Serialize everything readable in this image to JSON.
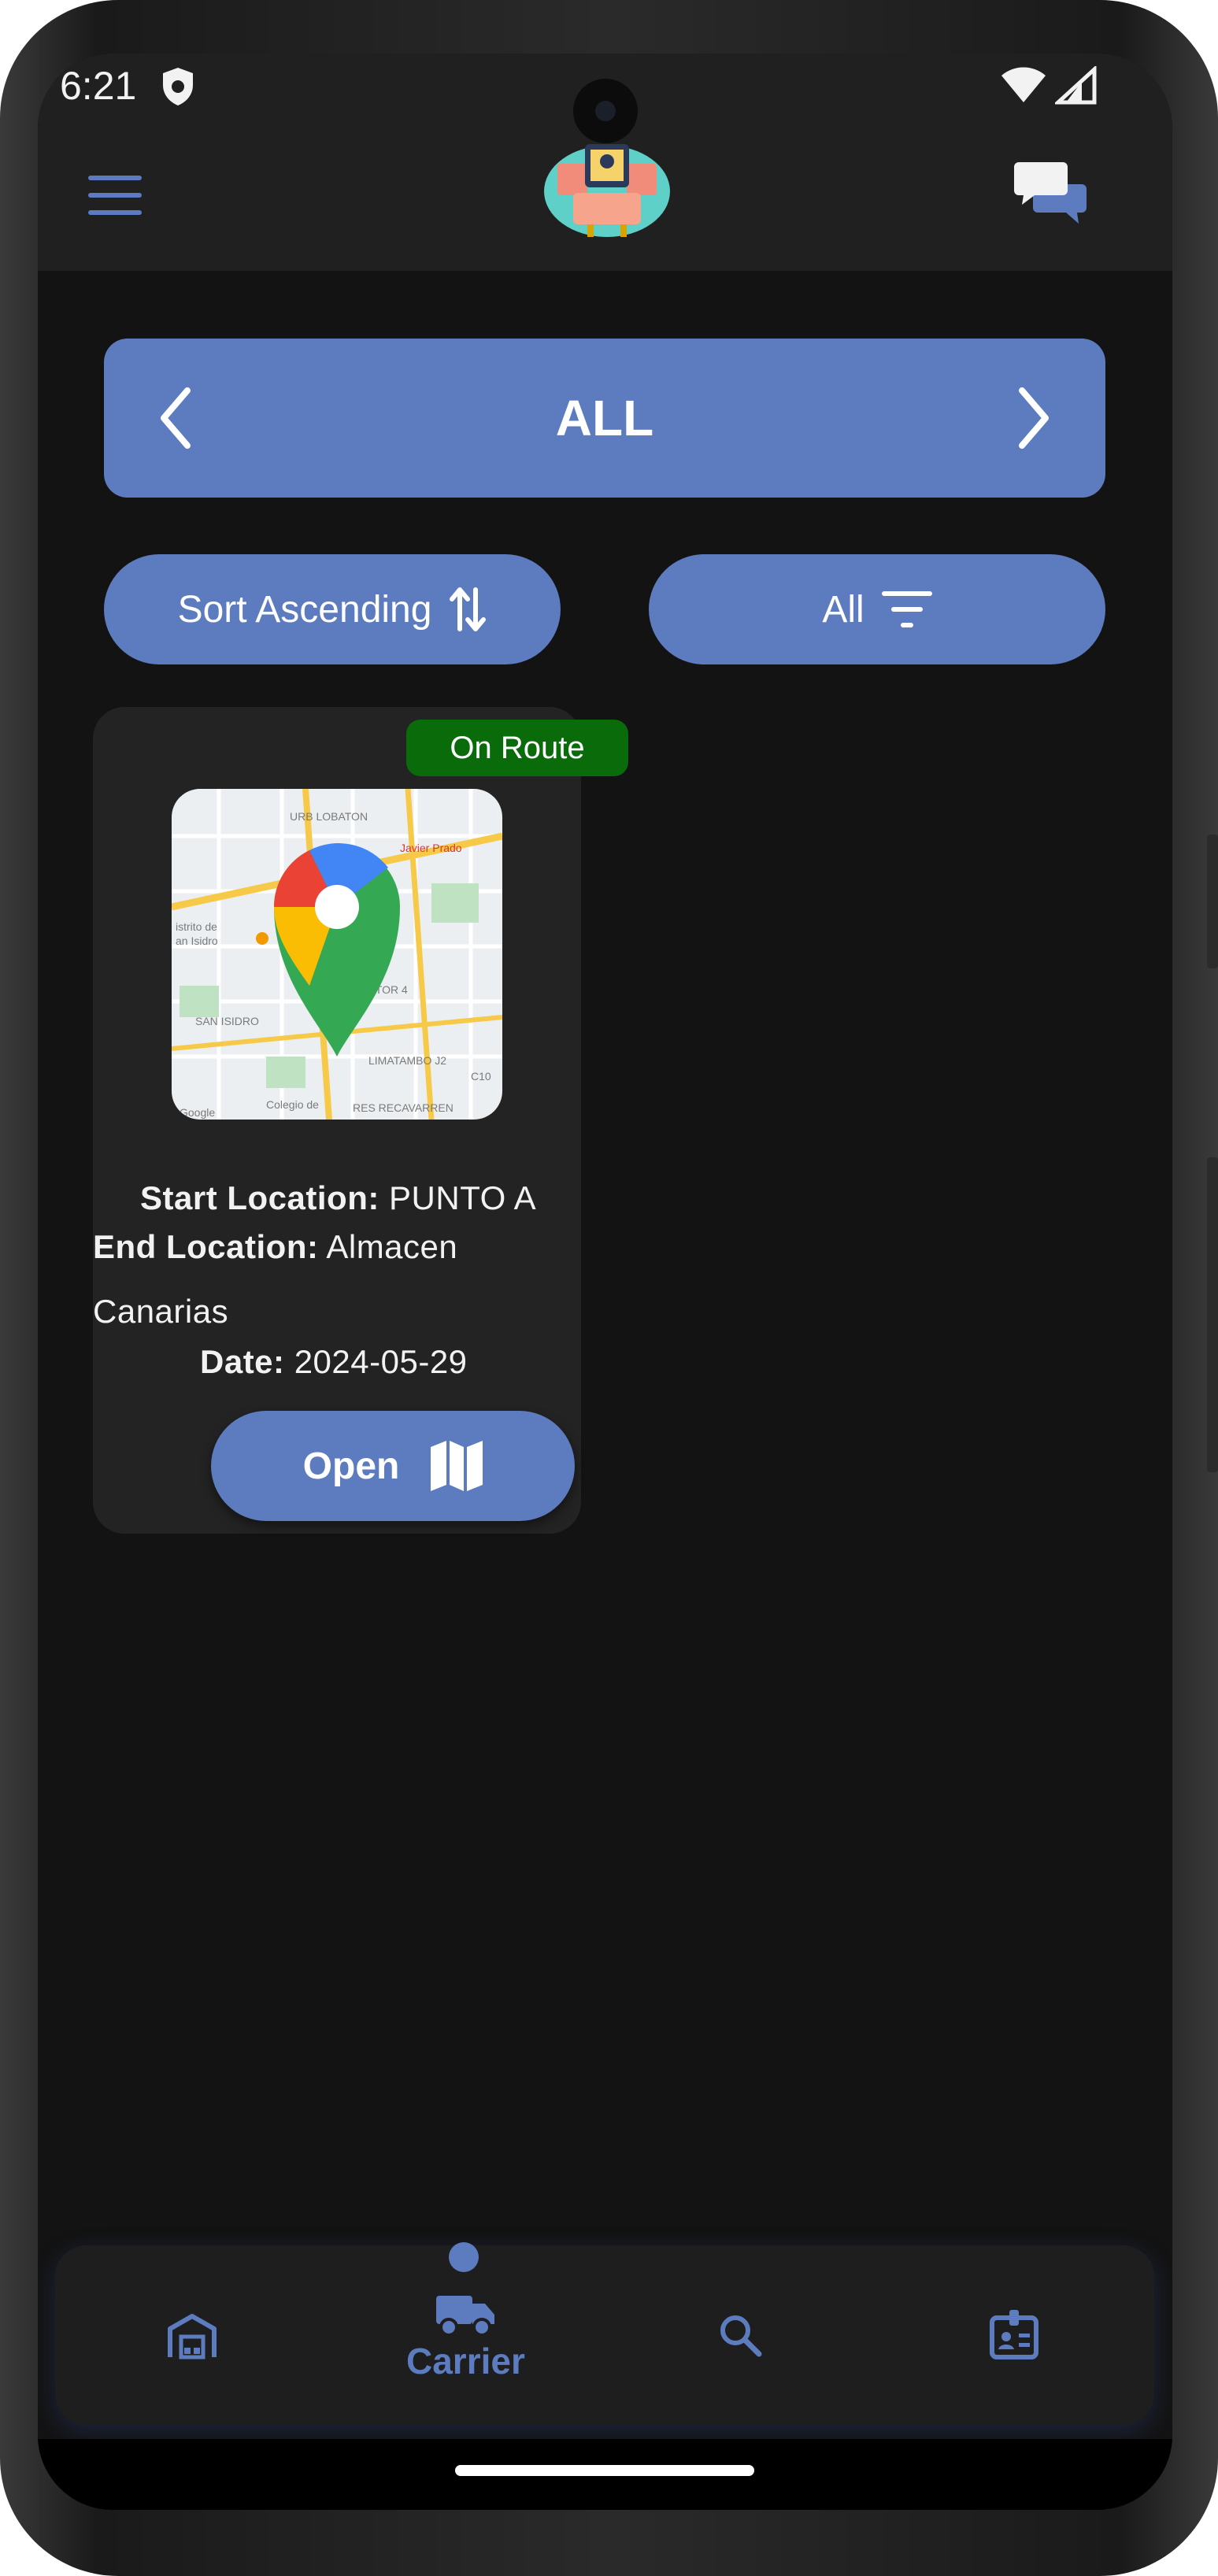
{
  "status_bar": {
    "time": "6:21",
    "icons": [
      "shield-icon",
      "wifi-icon",
      "signal-icon"
    ]
  },
  "header": {
    "menu_icon": "hamburger-menu-icon",
    "logo": "app-logo",
    "chat_icon": "chat-bubbles-icon"
  },
  "selector": {
    "label": "ALL",
    "prev_icon": "chevron-left-icon",
    "next_icon": "chevron-right-icon"
  },
  "sort_button": {
    "label": "Sort Ascending",
    "icon": "sort-arrows-icon"
  },
  "filter_button": {
    "label": "All",
    "icon": "filter-lines-icon"
  },
  "route_card": {
    "status": "On Route",
    "status_color": "#0a6b0a",
    "start_label": "Start Location:",
    "start_value": "PUNTO A",
    "end_label": "End Location:",
    "end_value_line1": "Almacen",
    "end_value_line2": "Canarias",
    "date_label": "Date:",
    "date_value": "2024-05-29",
    "open_label": "Open",
    "open_icon": "map-icon",
    "map_texts": {
      "t1": "URB LOBATON",
      "t2": "istrito de",
      "t3": "an Isidro",
      "t4": "SAN ISIDRO",
      "t5": "SECTOR 4",
      "t6": "LIMATAMBO J2",
      "t7": "RES RECAVARREN",
      "t8": "Google",
      "t9": "Colegio de",
      "t10": "C10",
      "t11": "Javier Prado"
    }
  },
  "bottom_nav": {
    "items": [
      {
        "icon": "warehouse-icon"
      },
      {
        "icon": "truck-icon",
        "label": "Carrier",
        "active": true
      },
      {
        "icon": "search-icon"
      },
      {
        "icon": "id-badge-icon"
      }
    ]
  },
  "colors": {
    "accent": "#5d7bbf",
    "background": "#131313",
    "surface": "#232323",
    "header": "#202020"
  }
}
